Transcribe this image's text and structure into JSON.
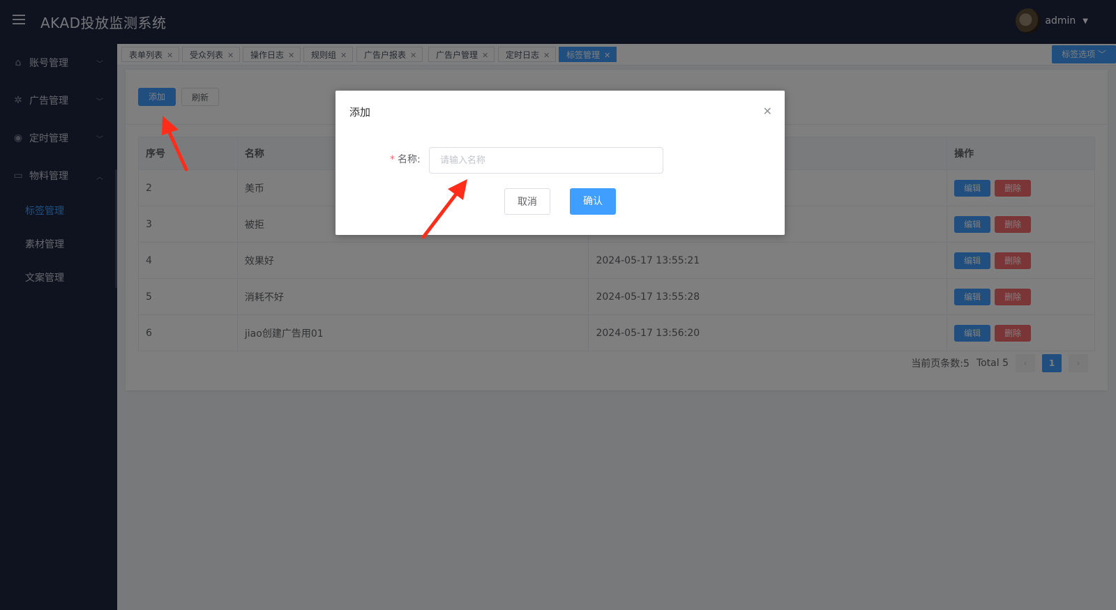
{
  "app": {
    "title": "AKAD投放监测系统",
    "user": "admin"
  },
  "sidebar": {
    "menus": [
      {
        "label": "账号管理",
        "icon": "home-icon"
      },
      {
        "label": "广告管理",
        "icon": "aperture-icon"
      },
      {
        "label": "定时管理",
        "icon": "eye-icon"
      },
      {
        "label": "物料管理",
        "icon": "document-icon"
      }
    ],
    "submenu": [
      "标签管理",
      "素材管理",
      "文案管理"
    ]
  },
  "tabs": [
    "表单列表",
    "受众列表",
    "操作日志",
    "规则组",
    "广告户报表",
    "广告户管理",
    "定时日志",
    "标签管理"
  ],
  "tab_options_label": "标签选项",
  "toolbar": {
    "add": "添加",
    "refresh": "刷新"
  },
  "table": {
    "headers": [
      "序号",
      "名称",
      "",
      "操作"
    ],
    "rows": [
      {
        "id": "2",
        "name": "美币",
        "time": ""
      },
      {
        "id": "3",
        "name": "被拒",
        "time": ""
      },
      {
        "id": "4",
        "name": "效果好",
        "time": "2024-05-17 13:55:21"
      },
      {
        "id": "5",
        "name": "消耗不好",
        "time": "2024-05-17 13:55:28"
      },
      {
        "id": "6",
        "name": "jiao创建广告用01",
        "time": "2024-05-17 13:56:20"
      }
    ],
    "edit_label": "编辑",
    "delete_label": "删除"
  },
  "pagination": {
    "page_count_text": "当前页条数:5",
    "total_text": "Total 5",
    "current_page": "1"
  },
  "dialog": {
    "title": "添加",
    "field_label": "名称:",
    "required_mark": "*",
    "placeholder": "请输入名称",
    "cancel": "取消",
    "confirm": "确认"
  },
  "colors": {
    "primary": "#409eff",
    "danger": "#f56c6c",
    "nav_bg": "#1f2740",
    "annotation_arrow": "#ff2d1a"
  }
}
